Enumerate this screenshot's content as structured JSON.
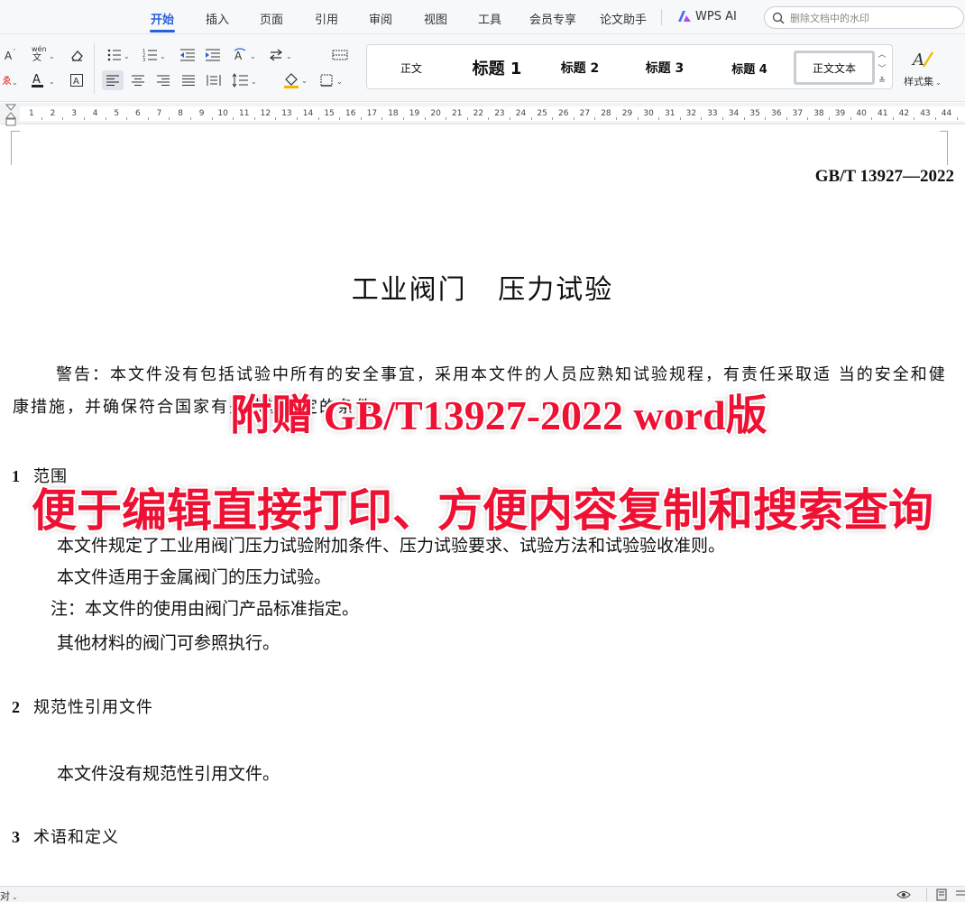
{
  "menu": {
    "tabs": [
      {
        "label": "开始",
        "active": true
      },
      {
        "label": "插入"
      },
      {
        "label": "页面"
      },
      {
        "label": "引用"
      },
      {
        "label": "审阅"
      },
      {
        "label": "视图"
      },
      {
        "label": "工具"
      },
      {
        "label": "会员专享"
      },
      {
        "label": "论文助手"
      }
    ],
    "wps_ai_label": "WPS AI",
    "search_placeholder": "删除文档中的水印",
    "accent_color": "#2b5fd9"
  },
  "toolbar": {
    "styles": [
      {
        "label": "正文"
      },
      {
        "label": "标题 1"
      },
      {
        "label": "标题 2"
      },
      {
        "label": "标题 3"
      },
      {
        "label": "标题 4"
      },
      {
        "label": "正文文本",
        "current": true
      }
    ],
    "styleset_label": "样式集",
    "pinyin_glyph": "wén",
    "font_color": "#d81e06",
    "highlight_color": "#f3b700"
  },
  "ruler": {
    "numbers": [
      "1",
      "2",
      "3",
      "4",
      "5",
      "6",
      "7",
      "8",
      "9",
      "10",
      "11",
      "12",
      "13",
      "14",
      "15",
      "16",
      "17",
      "18",
      "19",
      "20",
      "21",
      "22",
      "23",
      "24",
      "25",
      "26",
      "27",
      "28",
      "29",
      "30",
      "31",
      "32",
      "33",
      "34",
      "35",
      "36",
      "37",
      "38",
      "39",
      "40",
      "41",
      "42",
      "43",
      "44"
    ]
  },
  "document": {
    "standard_number": "GB/T 13927—2022",
    "title": "工业阀门   压力试验",
    "warning": "警告：本文件没有包括试验中所有的安全事宜，采用本文件的人员应熟知试验规程，有责任采取适 当的安全和健康措施，并确保符合国家有关法规规定的条件。",
    "sections": [
      {
        "num": "1",
        "title": "范围"
      },
      {
        "num": "2",
        "title": "规范性引用文件"
      },
      {
        "num": "3",
        "title": "术语和定义"
      }
    ],
    "scope_paragraphs": [
      "本文件规定了工业用阀门压力试验附加条件、压力试验要求、试验方法和试验验收准则。",
      "本文件适用于金属阀门的压力试验。"
    ],
    "note": "注：本文件的使用由阀门产品标准指定。",
    "other": "其他材料的阀门可参照执行。",
    "normative_text": "本文件没有规范性引用文件。"
  },
  "promo": {
    "line1": "附赠 GB/T13927-2022 word版",
    "line2": "便于编辑直接打印、方便内容复制和搜索查询",
    "color": "#ee1133"
  },
  "status": {
    "left_text": "对"
  }
}
